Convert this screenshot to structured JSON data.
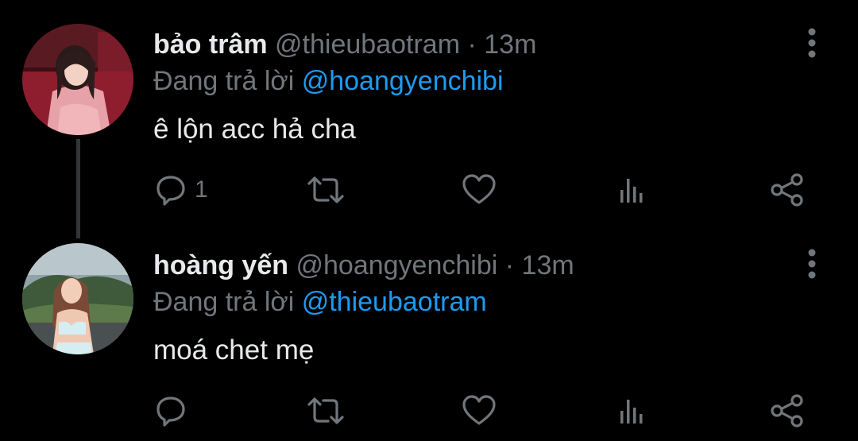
{
  "tweets": [
    {
      "display_name": "bảo trâm",
      "handle": "@thieubaotram",
      "separator": "·",
      "time": "13m",
      "replying_prefix": "Đang trả lời",
      "replying_to": "@hoangyenchibi",
      "text": "ê lộn acc hả cha",
      "reply_count": "1",
      "avatar": "avatar-photo-pink-outfit"
    },
    {
      "display_name": "hoàng yến",
      "handle": "@hoangyenchibi",
      "separator": "·",
      "time": "13m",
      "replying_prefix": "Đang trả lời",
      "replying_to": "@thieubaotram",
      "text": "moá chet mẹ",
      "reply_count": "",
      "avatar": "avatar-photo-outdoor"
    }
  ],
  "icons": {
    "reply": "reply-icon",
    "retweet": "retweet-icon",
    "like": "heart-icon",
    "views": "views-icon",
    "share": "share-icon",
    "more": "more-vertical-icon"
  },
  "colors": {
    "background": "#000000",
    "primary_text": "#e7e9ea",
    "secondary_text": "#71767b",
    "accent": "#1d9bf0",
    "thread_line": "#333639"
  }
}
